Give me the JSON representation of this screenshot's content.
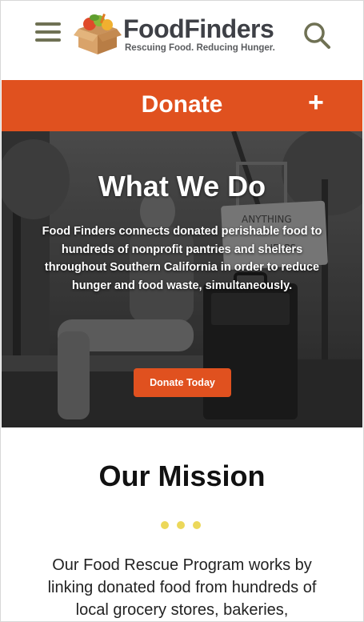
{
  "header": {
    "logo_name": "FoodFinders",
    "logo_tagline": "Rescuing Food. Reducing Hunger.",
    "menu_icon": "hamburger-menu-icon",
    "search_icon": "search-icon"
  },
  "donate_bar": {
    "label": "Donate",
    "plus": "+",
    "color": "#e0511f"
  },
  "hero": {
    "title": "What We Do",
    "body": "Food Finders connects donated perishable food to hundreds of nonprofit pantries and shelters throughout Southern California in order to reduce hunger and food waste, simultaneously.",
    "button_label": "Donate Today",
    "sign_text": "ANYTHING HELPS"
  },
  "mission": {
    "title": "Our Mission",
    "body": "Our Food Rescue Program works by linking donated food from hundreds of local grocery stores, bakeries,"
  },
  "colors": {
    "accent": "#e0511f",
    "dots": "#ecd85a",
    "menu": "#6f7154"
  }
}
